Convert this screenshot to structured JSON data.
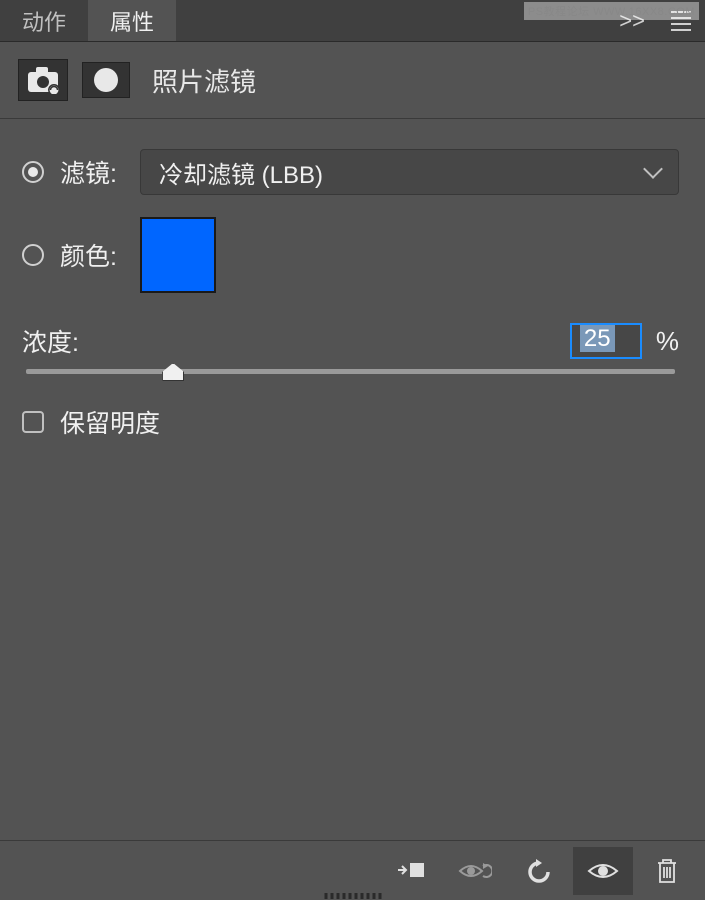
{
  "watermark": "PS教程论坛 WWW.16XX8.COM",
  "tabs": {
    "actions": "动作",
    "properties": "属性"
  },
  "panel": {
    "title": "照片滤镜"
  },
  "filter": {
    "label": "滤镜:",
    "selected": "冷却滤镜 (LBB)"
  },
  "color": {
    "label": "颜色:",
    "hex": "#0066ff"
  },
  "density": {
    "label": "浓度:",
    "value": "25",
    "unit": "%"
  },
  "preserve": {
    "label": "保留明度"
  },
  "collapse_label": ">>"
}
